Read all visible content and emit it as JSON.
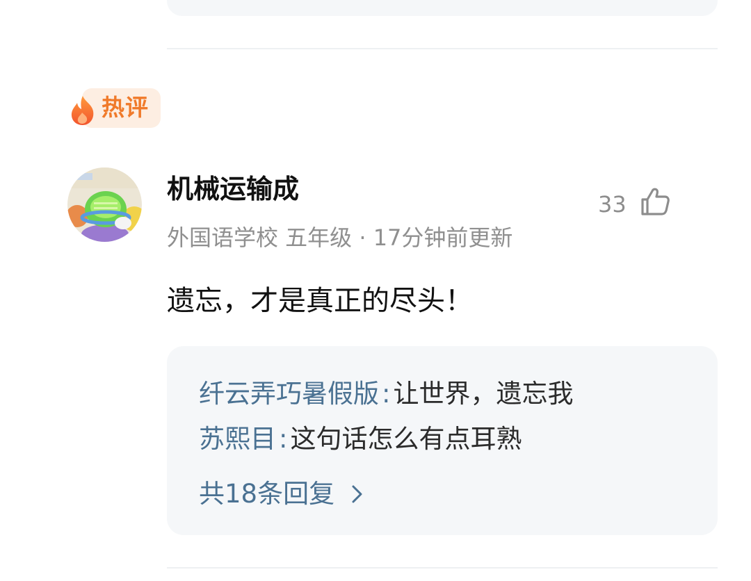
{
  "hot_tag": {
    "label": "热评"
  },
  "comment": {
    "username": "机械运输成",
    "meta": "外国语学校 五年级 · 17分钟前更新",
    "text": "遗忘，才是真正的尽头！",
    "likes": "33"
  },
  "replies": {
    "items": [
      {
        "name": "纤云弄巧暑假版",
        "colon": ":",
        "text": "让世界，遗忘我"
      },
      {
        "name": "苏熙目",
        "colon": ":",
        "text": "这句话怎么有点耳熟"
      }
    ],
    "more_label": "共18条回复"
  },
  "icons": {
    "flame": "flame-icon",
    "like": "thumbs-up-icon",
    "chevron": "chevron-right-icon"
  },
  "colors": {
    "accent_orange": "#f07a2a",
    "reply_name": "#4a7192",
    "meta_gray": "#8f8f8f"
  }
}
